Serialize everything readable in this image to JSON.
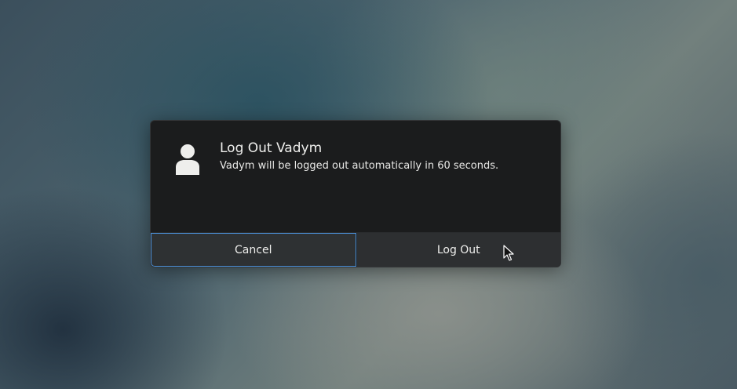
{
  "dialog": {
    "title": "Log Out Vadym",
    "message": "Vadym will be logged out automatically in 60 seconds.",
    "avatar_icon": "user-avatar-icon",
    "buttons": {
      "cancel_label": "Cancel",
      "logout_label": "Log Out"
    },
    "focus_color": "#4a90d9"
  },
  "pointer": {
    "icon": "mouse-pointer-icon"
  }
}
